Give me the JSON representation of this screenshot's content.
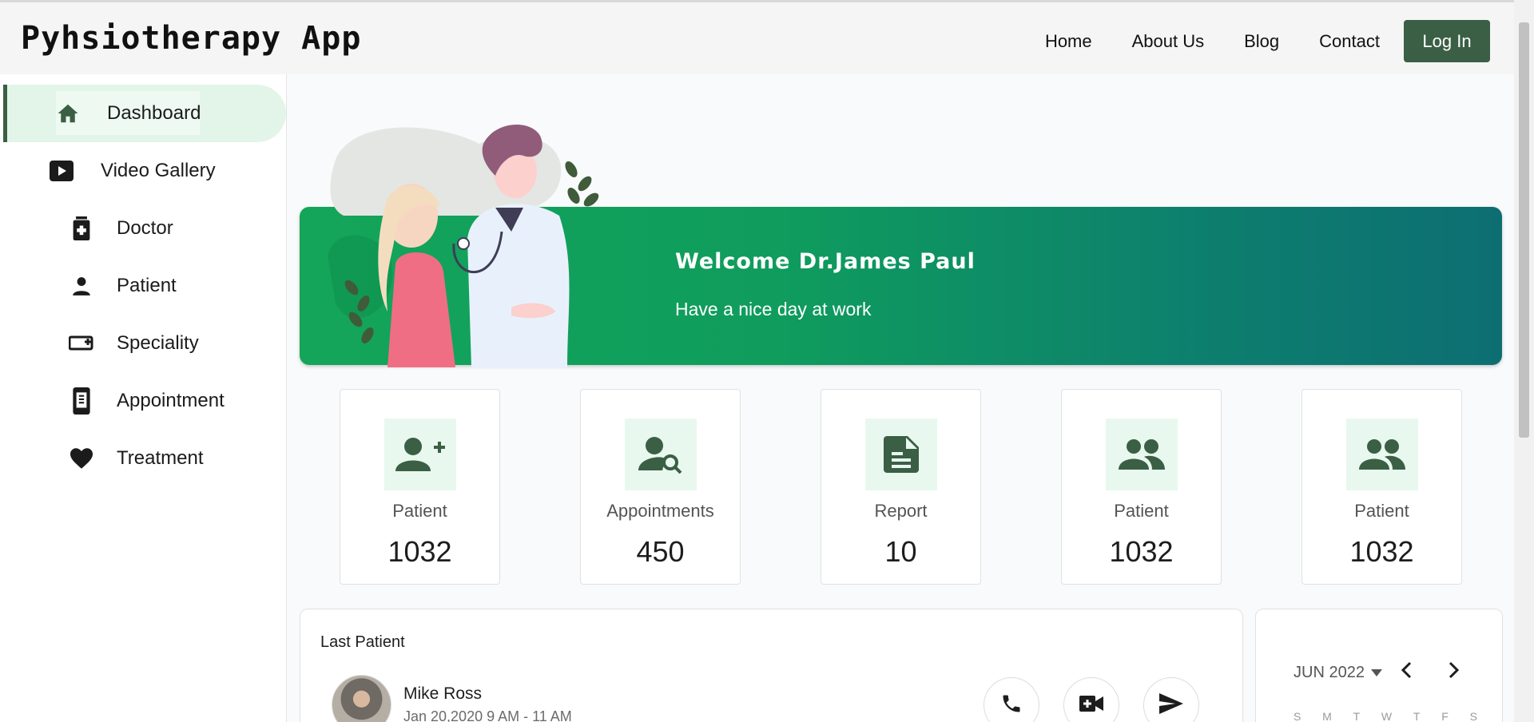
{
  "header": {
    "brand": "Pyhsiotherapy App",
    "nav": [
      "Home",
      "About Us",
      "Blog",
      "Contact"
    ],
    "login": "Log In"
  },
  "sidebar": {
    "items": [
      {
        "label": "Dashboard",
        "icon": "home-icon"
      },
      {
        "label": "Video Gallery",
        "icon": "play-icon"
      },
      {
        "label": "Doctor",
        "icon": "medical-kit-icon"
      },
      {
        "label": "Patient",
        "icon": "person-icon"
      },
      {
        "label": "Speciality",
        "icon": "card-add-icon"
      },
      {
        "label": "Appointment",
        "icon": "phone-calendar-icon"
      },
      {
        "label": "Treatment",
        "icon": "heart-icon"
      }
    ]
  },
  "banner": {
    "welcome": "Welcome Dr.James Paul",
    "subtitle": "Have a nice day at work",
    "illustration": "doctor-patient-illustration"
  },
  "stats": [
    {
      "label": "Patient",
      "value": "1032",
      "icon": "person-add-icon"
    },
    {
      "label": "Appointments",
      "value": "450",
      "icon": "person-search-icon"
    },
    {
      "label": "Report",
      "value": "10",
      "icon": "document-icon"
    },
    {
      "label": "Patient",
      "value": "1032",
      "icon": "people-icon"
    },
    {
      "label": "Patient",
      "value": "1032",
      "icon": "people-icon"
    }
  ],
  "last_patient": {
    "title": "Last Patient",
    "name": "Mike Ross",
    "date": "Jan 20,2020 9 AM - 11 AM"
  },
  "calendar": {
    "month": "JUN 2022",
    "weekdays": [
      "S",
      "M",
      "T",
      "W",
      "T",
      "F",
      "S"
    ]
  },
  "colors": {
    "accent": "#3b5f45",
    "banner_start": "#14a55a",
    "banner_end": "#0d6e72",
    "icon_bg": "#e8f8ee",
    "active_bg": "#e2f5e8"
  }
}
